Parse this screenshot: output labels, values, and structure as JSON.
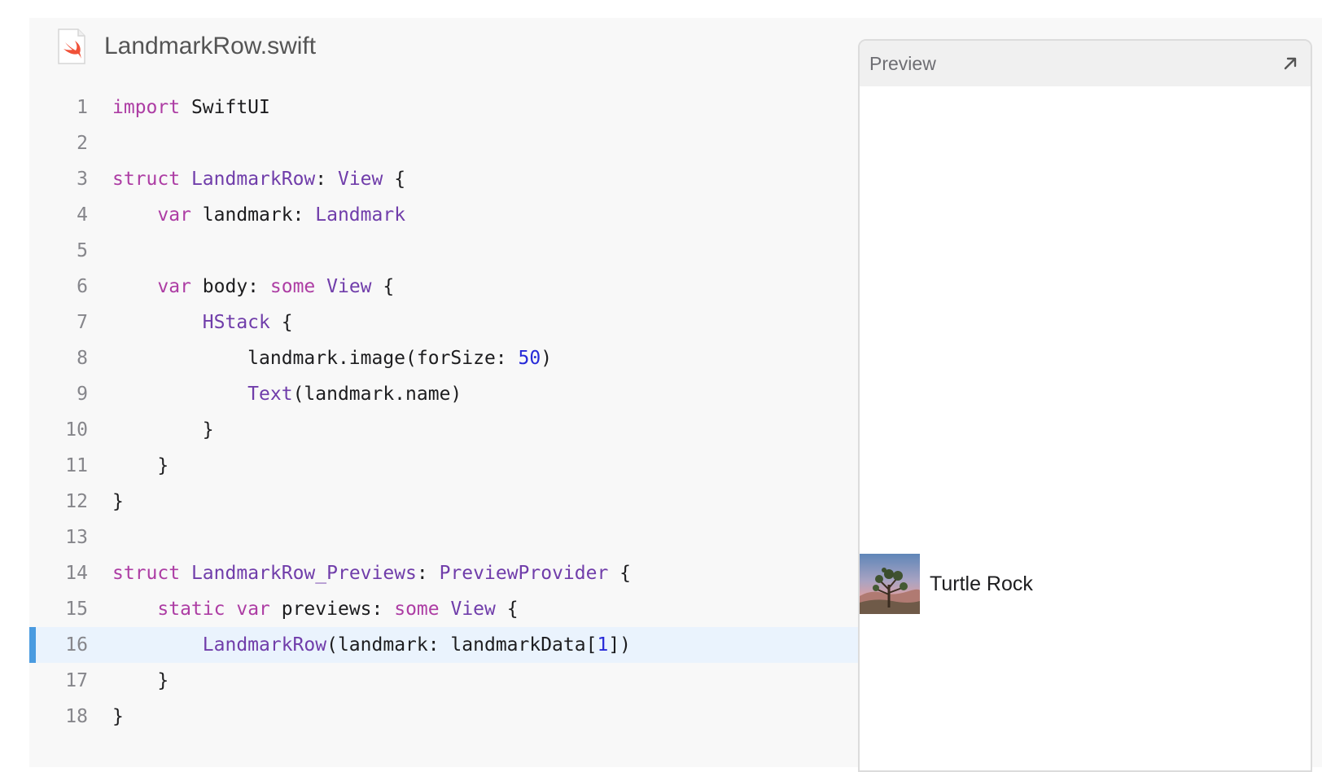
{
  "file": {
    "name": "LandmarkRow.swift",
    "icon": "swift-file-icon"
  },
  "colors": {
    "keyword": "#ad3da4",
    "type": "#703daa",
    "number": "#272ad8",
    "plain": "#1d1d1f",
    "line_number": "#86868b",
    "active_line_bg": "#eaf3fd",
    "active_line_marker": "#4a9be0"
  },
  "code": {
    "active_line": 16,
    "lines": [
      {
        "n": "1",
        "tokens": [
          {
            "t": "import",
            "c": "kw"
          },
          {
            "t": " SwiftUI",
            "c": "pl"
          }
        ]
      },
      {
        "n": "2",
        "tokens": []
      },
      {
        "n": "3",
        "tokens": [
          {
            "t": "struct",
            "c": "kw"
          },
          {
            "t": " ",
            "c": "pl"
          },
          {
            "t": "LandmarkRow",
            "c": "ty"
          },
          {
            "t": ": ",
            "c": "pl"
          },
          {
            "t": "View",
            "c": "ty"
          },
          {
            "t": " {",
            "c": "pl"
          }
        ]
      },
      {
        "n": "4",
        "tokens": [
          {
            "t": "    ",
            "c": "pl"
          },
          {
            "t": "var",
            "c": "kw"
          },
          {
            "t": " landmark: ",
            "c": "pl"
          },
          {
            "t": "Landmark",
            "c": "ty"
          }
        ]
      },
      {
        "n": "5",
        "tokens": []
      },
      {
        "n": "6",
        "tokens": [
          {
            "t": "    ",
            "c": "pl"
          },
          {
            "t": "var",
            "c": "kw"
          },
          {
            "t": " body: ",
            "c": "pl"
          },
          {
            "t": "some",
            "c": "kw"
          },
          {
            "t": " ",
            "c": "pl"
          },
          {
            "t": "View",
            "c": "ty"
          },
          {
            "t": " {",
            "c": "pl"
          }
        ]
      },
      {
        "n": "7",
        "tokens": [
          {
            "t": "        ",
            "c": "pl"
          },
          {
            "t": "HStack",
            "c": "ty"
          },
          {
            "t": " {",
            "c": "pl"
          }
        ]
      },
      {
        "n": "8",
        "tokens": [
          {
            "t": "            landmark.image(forSize: ",
            "c": "pl"
          },
          {
            "t": "50",
            "c": "num"
          },
          {
            "t": ")",
            "c": "pl"
          }
        ]
      },
      {
        "n": "9",
        "tokens": [
          {
            "t": "            ",
            "c": "pl"
          },
          {
            "t": "Text",
            "c": "ty"
          },
          {
            "t": "(landmark.name)",
            "c": "pl"
          }
        ]
      },
      {
        "n": "10",
        "tokens": [
          {
            "t": "        }",
            "c": "pl"
          }
        ]
      },
      {
        "n": "11",
        "tokens": [
          {
            "t": "    }",
            "c": "pl"
          }
        ]
      },
      {
        "n": "12",
        "tokens": [
          {
            "t": "}",
            "c": "pl"
          }
        ]
      },
      {
        "n": "13",
        "tokens": []
      },
      {
        "n": "14",
        "tokens": [
          {
            "t": "struct",
            "c": "kw"
          },
          {
            "t": " ",
            "c": "pl"
          },
          {
            "t": "LandmarkRow_Previews",
            "c": "ty"
          },
          {
            "t": ": ",
            "c": "pl"
          },
          {
            "t": "PreviewProvider",
            "c": "ty"
          },
          {
            "t": " {",
            "c": "pl"
          }
        ]
      },
      {
        "n": "15",
        "tokens": [
          {
            "t": "    ",
            "c": "pl"
          },
          {
            "t": "static",
            "c": "kw"
          },
          {
            "t": " ",
            "c": "pl"
          },
          {
            "t": "var",
            "c": "kw"
          },
          {
            "t": " previews: ",
            "c": "pl"
          },
          {
            "t": "some",
            "c": "kw"
          },
          {
            "t": " ",
            "c": "pl"
          },
          {
            "t": "View",
            "c": "ty"
          },
          {
            "t": " {",
            "c": "pl"
          }
        ]
      },
      {
        "n": "16",
        "tokens": [
          {
            "t": "        ",
            "c": "pl"
          },
          {
            "t": "LandmarkRow",
            "c": "ty"
          },
          {
            "t": "(landmark: landmarkData[",
            "c": "pl"
          },
          {
            "t": "1",
            "c": "num"
          },
          {
            "t": "])",
            "c": "pl"
          }
        ]
      },
      {
        "n": "17",
        "tokens": [
          {
            "t": "    }",
            "c": "pl"
          }
        ]
      },
      {
        "n": "18",
        "tokens": [
          {
            "t": "}",
            "c": "pl"
          }
        ]
      }
    ]
  },
  "preview": {
    "title": "Preview",
    "expand_icon": "expand-arrow-icon",
    "row": {
      "label": "Turtle Rock",
      "thumbnail": "landmark-thumbnail"
    }
  }
}
